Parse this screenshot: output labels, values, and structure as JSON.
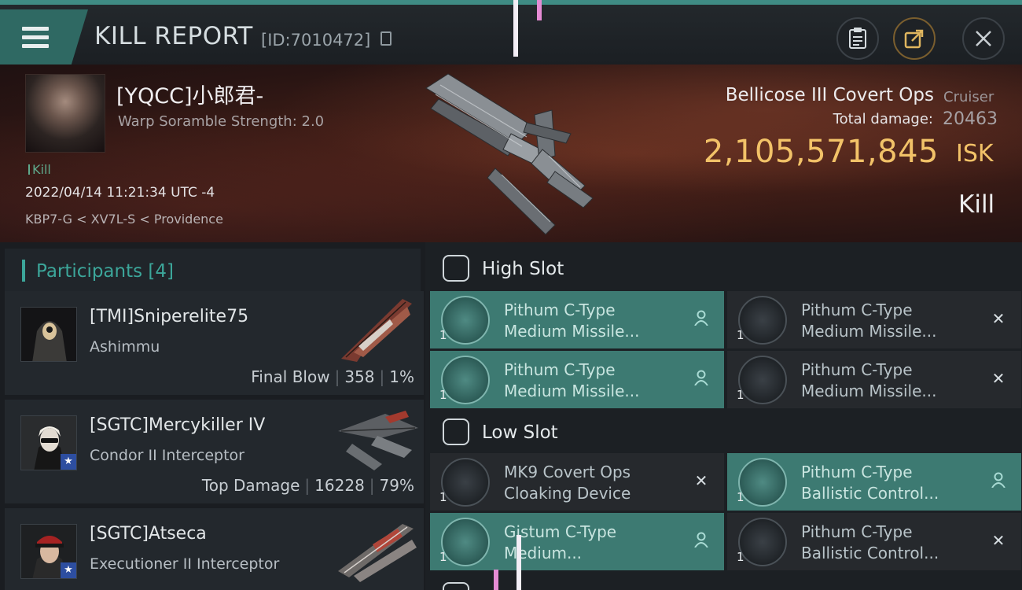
{
  "header": {
    "title": "KILL REPORT",
    "report_id": "[ID:7010472]",
    "icons": [
      "menu-icon",
      "clipboard-icon",
      "share-icon",
      "close-icon"
    ]
  },
  "victim": {
    "name": "[YQCC]小郎君-",
    "warp": "Warp Soramble Strength: 2.0",
    "kill_tag": "Kill",
    "time": "2022/04/14 11:21:34 UTC -4",
    "location": "KBP7-G < XV7L-S < Providence",
    "ship_name": "Bellicose III Covert Ops",
    "ship_class": "Cruiser",
    "damage_label": "Total damage:",
    "damage_value": "20463",
    "isk_value": "2,105,571,845",
    "isk_unit": "ISK",
    "result": "Kill"
  },
  "participants": {
    "label": "Participants [4]",
    "items": [
      {
        "name": "[TMI]Sniperelite75",
        "ship": "Ashimmu",
        "role": "Final Blow",
        "damage": "358",
        "percent": "1%",
        "star": false
      },
      {
        "name": "[SGTC]Mercykiller IV",
        "ship": "Condor II Interceptor",
        "role": "Top Damage",
        "damage": "16228",
        "percent": "79%",
        "star": true
      },
      {
        "name": "[SGTC]Atseca",
        "ship": "Executioner II Interceptor",
        "role": "",
        "damage": "",
        "percent": "",
        "star": true
      }
    ]
  },
  "fitting": {
    "high_slot_label": "High Slot",
    "low_slot_label": "Low Slot",
    "high": [
      {
        "line1": "Pithum C-Type",
        "line2": "Medium Missile...",
        "qty": "1",
        "state": "person-icon",
        "active": true
      },
      {
        "line1": "Pithum C-Type",
        "line2": "Medium Missile...",
        "qty": "1",
        "state": "close-icon",
        "active": false
      },
      {
        "line1": "Pithum C-Type",
        "line2": "Medium Missile...",
        "qty": "1",
        "state": "person-icon",
        "active": true
      },
      {
        "line1": "Pithum C-Type",
        "line2": "Medium Missile...",
        "qty": "1",
        "state": "close-icon",
        "active": false
      }
    ],
    "low": [
      {
        "line1": "MK9 Covert Ops",
        "line2": "Cloaking Device",
        "qty": "1",
        "state": "close-icon",
        "active": false
      },
      {
        "line1": "Pithum C-Type",
        "line2": "Ballistic Control...",
        "qty": "1",
        "state": "person-icon",
        "active": true
      },
      {
        "line1": "Gistum C-Type",
        "line2": "Medium...",
        "qty": "1",
        "state": "person-icon",
        "active": true
      },
      {
        "line1": "Pithum C-Type",
        "line2": "Ballistic Control...",
        "qty": "1",
        "state": "close-icon",
        "active": false
      }
    ]
  },
  "colors": {
    "accent": "#3ca69a",
    "isk": "#f2c268",
    "active_module": "#3d7a72"
  }
}
